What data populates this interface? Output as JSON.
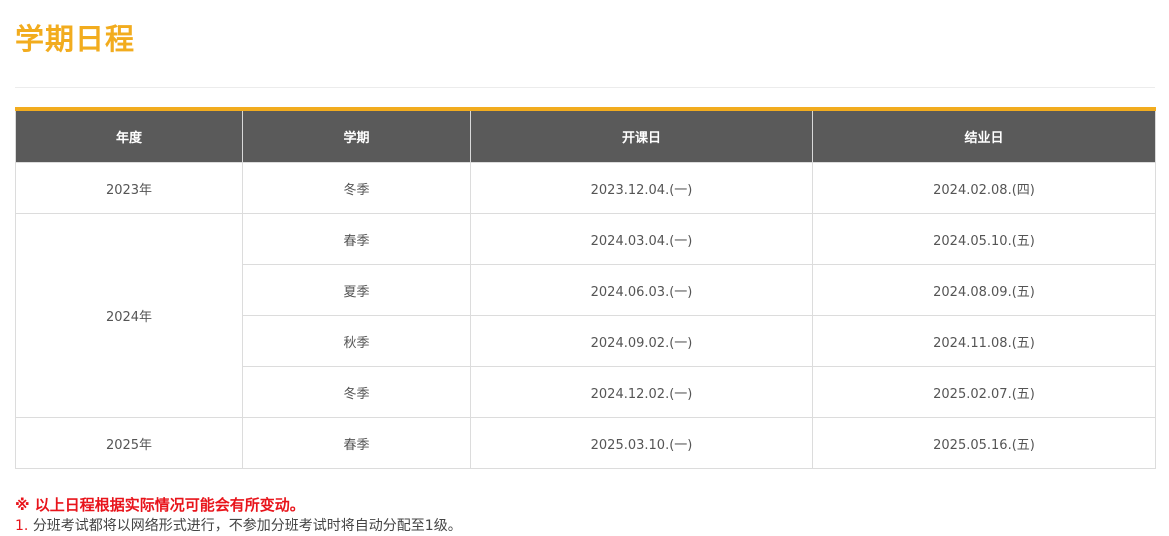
{
  "page": {
    "title": "学期日程"
  },
  "table": {
    "headers": {
      "year": "年度",
      "term": "学期",
      "start": "开课日",
      "end": "结业日"
    },
    "years": [
      "2023年",
      "2024年",
      "2025年"
    ],
    "rows": [
      {
        "term": "冬季",
        "start": "2023.12.04.(一)",
        "end": "2024.02.08.(四)"
      },
      {
        "term": "春季",
        "start": "2024.03.04.(一)",
        "end": "2024.05.10.(五)"
      },
      {
        "term": "夏季",
        "start": "2024.06.03.(一)",
        "end": "2024.08.09.(五)"
      },
      {
        "term": "秋季",
        "start": "2024.09.02.(一)",
        "end": "2024.11.08.(五)"
      },
      {
        "term": "冬季",
        "start": "2024.12.02.(一)",
        "end": "2025.02.07.(五)"
      },
      {
        "term": "春季",
        "start": "2025.03.10.(一)",
        "end": "2025.05.16.(五)"
      }
    ]
  },
  "notes": {
    "notice": "※ 以上日程根据实际情况可能会有所变动。",
    "items": [
      {
        "number": "1.",
        "text": "分班考试都将以网络形式进行，不参加分班考试时将自动分配至1级。"
      }
    ]
  },
  "colors": {
    "accent": "#f2ac1e",
    "header_bg": "#5a5a5a",
    "notice_red": "#e8141b"
  }
}
